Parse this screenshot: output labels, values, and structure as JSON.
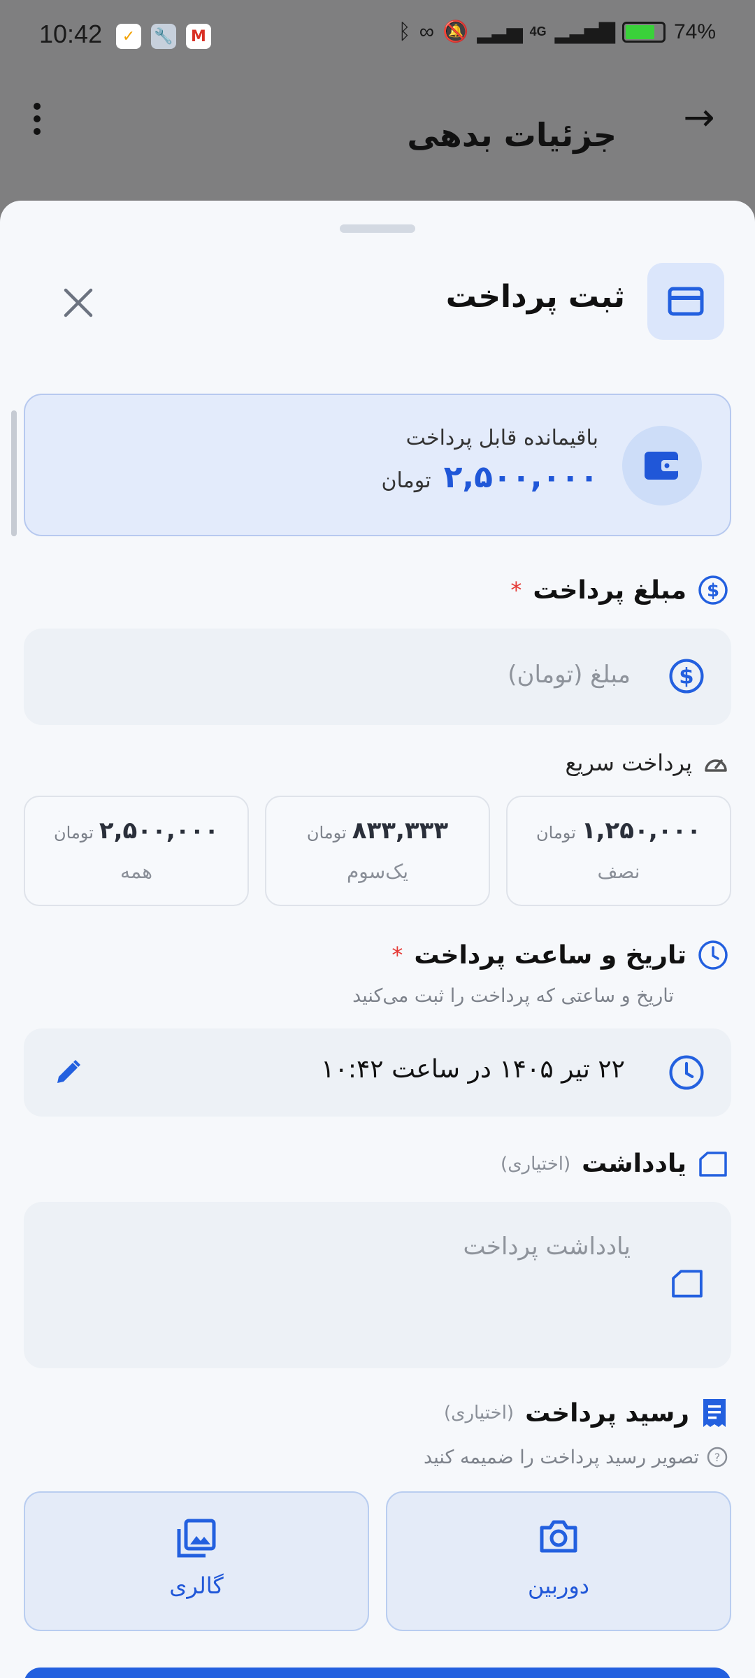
{
  "status_bar": {
    "time": "10:42",
    "network": "4G",
    "battery": "74%",
    "battery_level": 0.74
  },
  "header": {
    "title": "جزئیات بدهی"
  },
  "sheet": {
    "title": "ثبت پرداخت",
    "remaining": {
      "label": "باقیمانده قابل پرداخت",
      "amount": "۲,۵۰۰,۰۰۰",
      "unit": "تومان"
    },
    "amount": {
      "label": "مبلغ پرداخت",
      "required": "*",
      "placeholder": "مبلغ (تومان)"
    },
    "quick_pay": {
      "label": "پرداخت سریع",
      "options": [
        {
          "amount": "۱,۲۵۰,۰۰۰",
          "unit": "تومان",
          "name": "نصف"
        },
        {
          "amount": "۸۳۳,۳۳۳",
          "unit": "تومان",
          "name": "یک‌سوم"
        },
        {
          "amount": "۲,۵۰۰,۰۰۰",
          "unit": "تومان",
          "name": "همه"
        }
      ]
    },
    "datetime": {
      "label": "تاریخ و ساعت پرداخت",
      "required": "*",
      "helper": "تاریخ و ساعتی که پرداخت را ثبت می‌کنید",
      "value": "۲۲ تیر ۱۴۰۵ در ساعت ۱۰:۴۲"
    },
    "note": {
      "label": "یادداشت",
      "optional": "(اختیاری)",
      "placeholder": "یادداشت پرداخت"
    },
    "receipt": {
      "label": "رسید پرداخت",
      "optional": "(اختیاری)",
      "helper": "تصویر رسید پرداخت را ضمیمه کنید",
      "camera": "دوربین",
      "gallery": "گالری"
    }
  },
  "colors": {
    "accent": "#2360df",
    "sheet_bg": "#f6f8fb",
    "scrim": "#7f7f80"
  }
}
